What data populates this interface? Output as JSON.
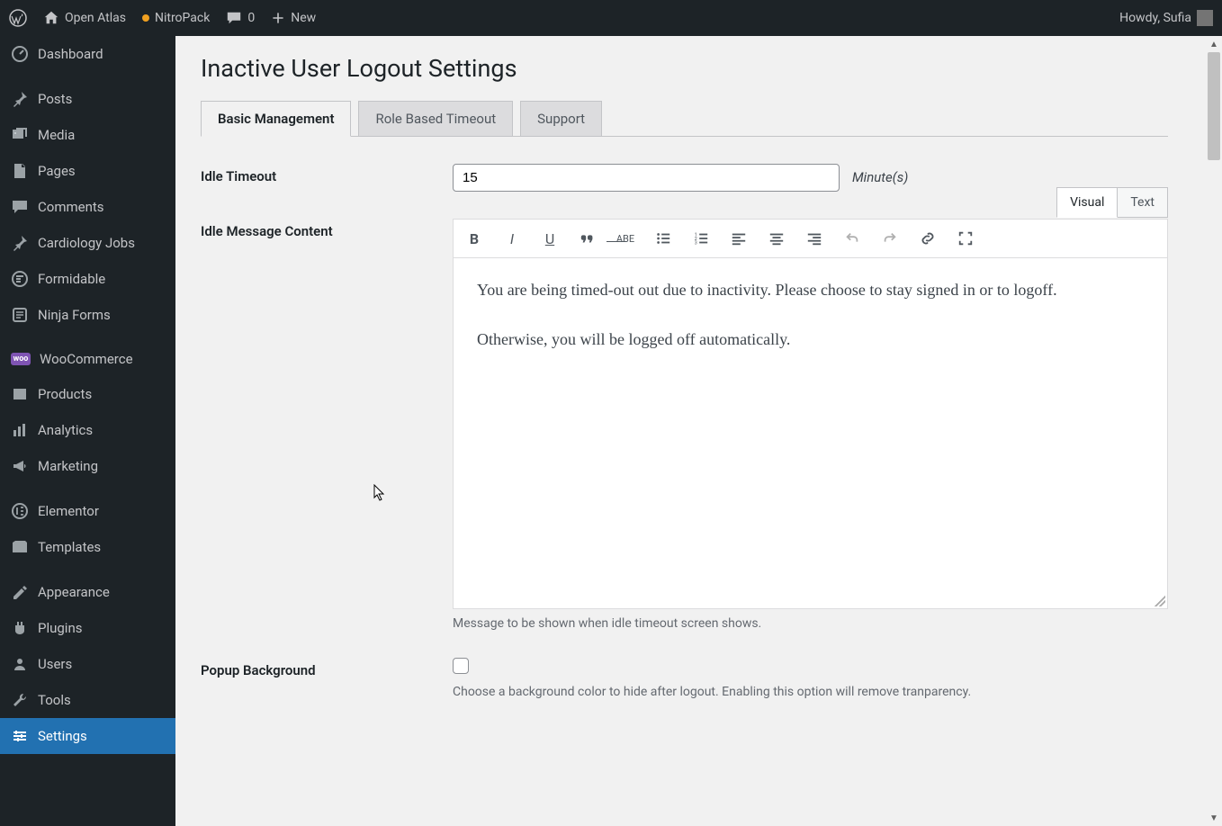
{
  "adminbar": {
    "site_name": "Open Atlas",
    "nitropack": "NitroPack",
    "comment_count": "0",
    "new_label": "New",
    "howdy": "Howdy, Sufia"
  },
  "sidebar": {
    "items": [
      {
        "icon": "dashboard",
        "label": "Dashboard"
      },
      {
        "icon": "pin",
        "label": "Posts"
      },
      {
        "icon": "media",
        "label": "Media"
      },
      {
        "icon": "page",
        "label": "Pages"
      },
      {
        "icon": "comment",
        "label": "Comments"
      },
      {
        "icon": "pin",
        "label": "Cardiology Jobs"
      },
      {
        "icon": "formidable",
        "label": "Formidable"
      },
      {
        "icon": "ninja",
        "label": "Ninja Forms"
      },
      {
        "icon": "woo",
        "label": "WooCommerce"
      },
      {
        "icon": "products",
        "label": "Products"
      },
      {
        "icon": "analytics",
        "label": "Analytics"
      },
      {
        "icon": "marketing",
        "label": "Marketing"
      },
      {
        "icon": "elementor",
        "label": "Elementor"
      },
      {
        "icon": "templates",
        "label": "Templates"
      },
      {
        "icon": "appearance",
        "label": "Appearance"
      },
      {
        "icon": "plugins",
        "label": "Plugins"
      },
      {
        "icon": "users",
        "label": "Users"
      },
      {
        "icon": "tools",
        "label": "Tools"
      },
      {
        "icon": "settings",
        "label": "Settings"
      }
    ]
  },
  "page": {
    "title": "Inactive User Logout Settings",
    "tabs": [
      {
        "label": "Basic Management",
        "active": true
      },
      {
        "label": "Role Based Timeout",
        "active": false
      },
      {
        "label": "Support",
        "active": false
      }
    ]
  },
  "form": {
    "idle_timeout_label": "Idle Timeout",
    "idle_timeout_value": "15",
    "idle_timeout_suffix": "Minute(s)",
    "idle_message_label": "Idle Message Content",
    "editor_tabs": {
      "visual": "Visual",
      "text": "Text"
    },
    "editor_content_p1": "You are being timed-out out due to inactivity. Please choose to stay signed in or to logoff.",
    "editor_content_p2": "Otherwise, you will be logged off automatically.",
    "editor_help": "Message to be shown when idle timeout screen shows.",
    "popup_bg_label": "Popup Background",
    "popup_bg_help": "Choose a background color to hide after logout. Enabling this option will remove tranparency."
  },
  "toolbar_buttons": [
    "bold",
    "italic",
    "underline",
    "quote",
    "strike",
    "ul",
    "ol",
    "align-left",
    "align-center",
    "align-right",
    "undo",
    "redo",
    "link",
    "fullscreen"
  ]
}
